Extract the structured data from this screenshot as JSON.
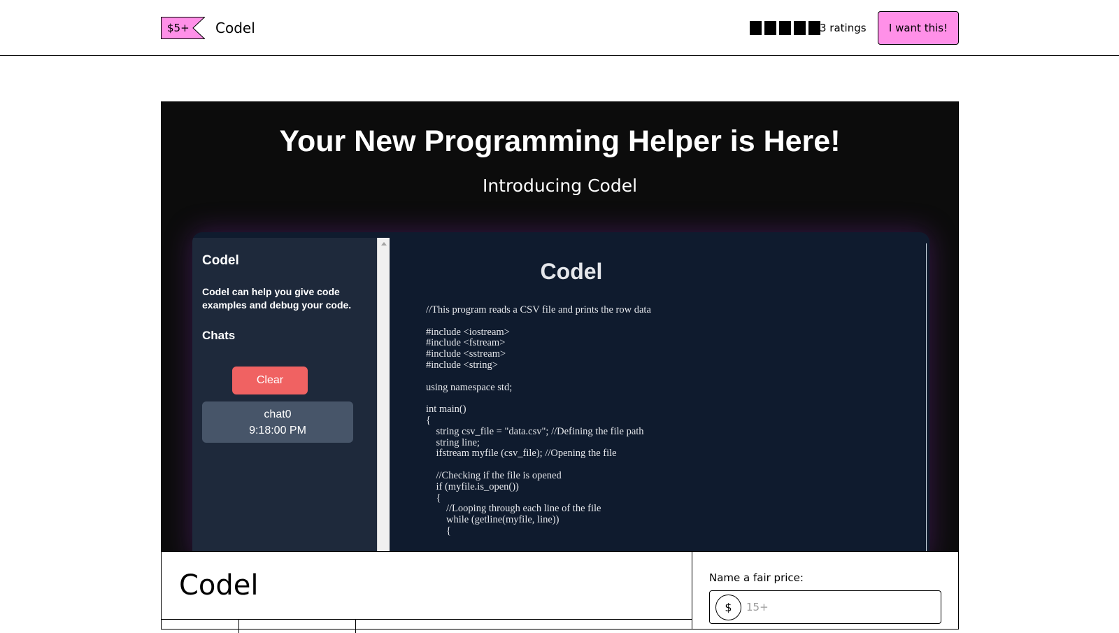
{
  "header": {
    "price_tag": "$5+",
    "product_name": "Codel",
    "rating_stars": 5,
    "ratings_count": "3 ratings",
    "cta_label": "I want this!"
  },
  "hero": {
    "title": "Your New Programming Helper is Here!",
    "subtitle": "Introducing Codel"
  },
  "app_preview": {
    "sidebar": {
      "title": "Codel",
      "description": "Codel can help you give code examples and debug your code.",
      "chats_heading": "Chats",
      "clear_label": "Clear",
      "chat_items": [
        {
          "name": "chat0",
          "time": "9:18:00 PM"
        }
      ]
    },
    "main_title": "Codel",
    "code": "//This program reads a CSV file and prints the row data\n\n#include <iostream>\n#include <fstream>\n#include <sstream>\n#include <string>\n\nusing namespace std;\n\nint main()\n{\n    string csv_file = \"data.csv\"; //Defining the file path\n    string line;\n    ifstream myfile (csv_file); //Opening the file\n\n    //Checking if the file is opened\n    if (myfile.is_open())\n    {\n        //Looping through each line of the file\n        while (getline(myfile, line))\n        {"
  },
  "product": {
    "title": "Codel"
  },
  "pricing": {
    "label": "Name a fair price:",
    "currency_symbol": "$",
    "placeholder": "15+"
  },
  "colors": {
    "accent_pink": "#ff90e8",
    "hero_bg": "#0c0c0c",
    "app_bg": "#0f1b2e",
    "sidebar_bg": "#1e293b",
    "clear_red": "#f06262",
    "chat_item_bg": "#475569"
  }
}
